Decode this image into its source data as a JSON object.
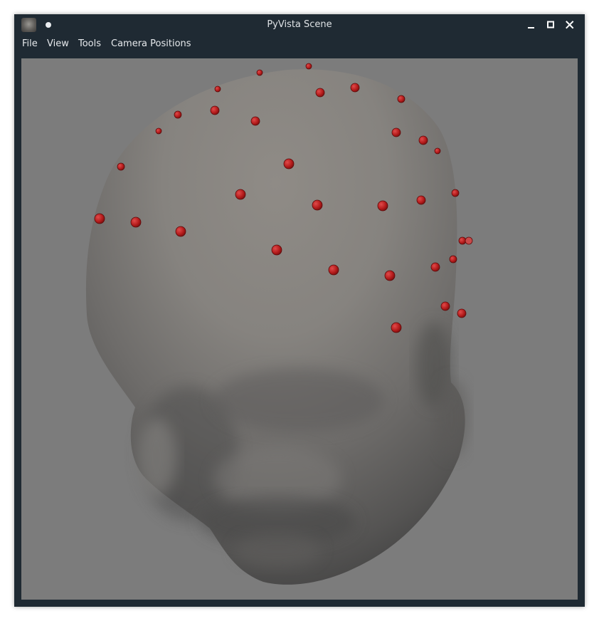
{
  "window": {
    "title": "PyVista Scene"
  },
  "icons": {
    "app": "pyvista-head-icon",
    "pin": "on-all-desktops-dot-icon",
    "minimize": "minimize-icon",
    "maximize": "maximize-icon",
    "close": "close-icon"
  },
  "menubar": {
    "file": "File",
    "view": "View",
    "tools": "Tools",
    "camera_positions": "Camera Positions"
  },
  "scene": {
    "background_color": "#7c7c7c",
    "mesh_color": "#8e8a85",
    "marker_color": "#b31b1b",
    "marker_count": 39
  },
  "colors": {
    "chrome": "#1f2a33",
    "chrome_text": "#dfe3e6"
  }
}
